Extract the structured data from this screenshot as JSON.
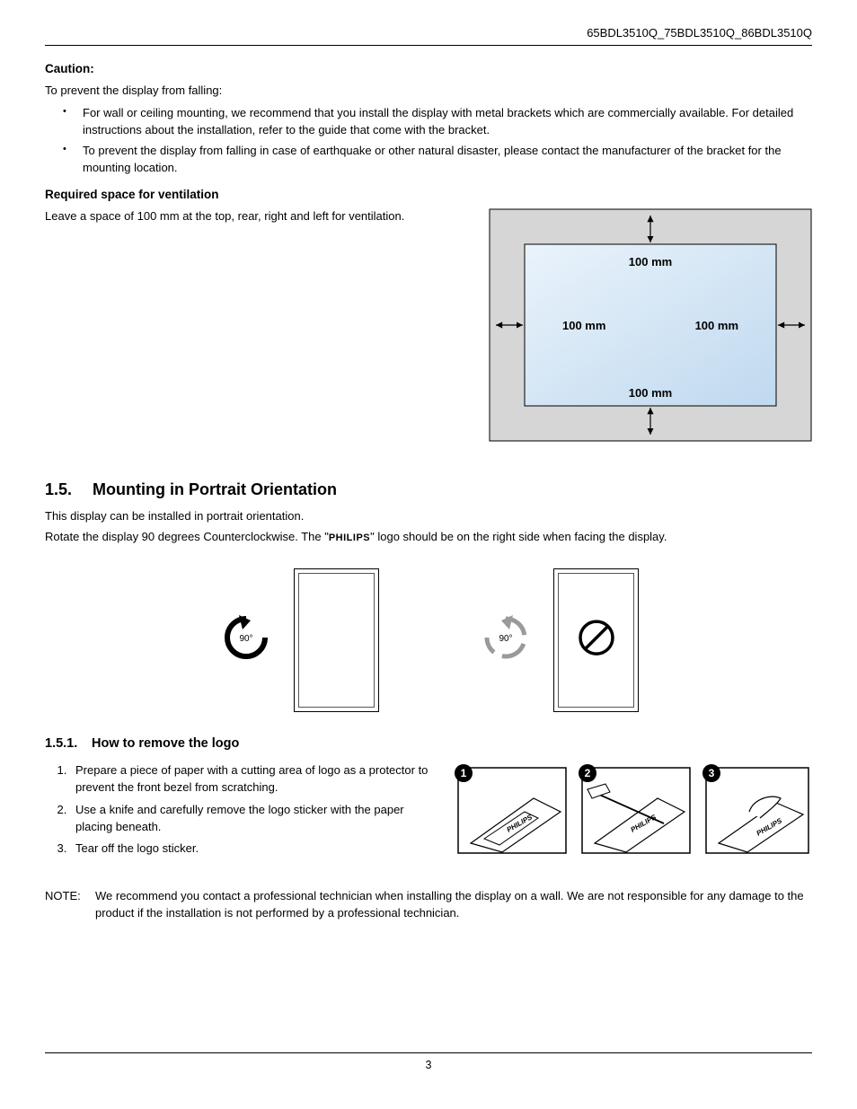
{
  "header": {
    "model_line": "65BDL3510Q_75BDL3510Q_86BDL3510Q"
  },
  "caution": {
    "heading": "Caution:",
    "intro": "To prevent the display from falling:",
    "bullets": [
      "For wall or ceiling mounting, we recommend that you install the display with metal brackets which are commercially available. For detailed instructions about the installation, refer to the guide that come with the bracket.",
      "To prevent the display from falling in case of earthquake or other natural disaster, please contact the manufacturer of the bracket for the mounting location."
    ]
  },
  "ventilation": {
    "heading": "Required space for ventilation",
    "text": "Leave a space of 100 mm at the top, rear, right and left for ventilation.",
    "labels": {
      "top": "100 mm",
      "left": "100 mm",
      "right": "100 mm",
      "bottom": "100 mm"
    }
  },
  "section15": {
    "number": "1.5.",
    "title": "Mounting in Portrait Orientation",
    "line1": "This display can be installed in portrait orientation.",
    "line2a": "Rotate the display 90 degrees Counterclockwise. The \"",
    "line2b": "\" logo should be on the right side when facing the display.",
    "philips": "PHILIPS",
    "deg_label": "90°"
  },
  "section151": {
    "number": "1.5.1.",
    "title": "How to remove the logo",
    "steps": [
      "Prepare a piece of paper with a cutting area of logo as a protector to prevent the front bezel from scratching.",
      "Use a knife and carefully remove the logo sticker with the paper placing beneath.",
      "Tear off the logo sticker."
    ],
    "badges": [
      "1",
      "2",
      "3"
    ],
    "sticker_label": "PHILIPS"
  },
  "note": {
    "label": "NOTE:",
    "text": "We recommend you contact a professional technician when installing the display on a wall. We are not responsible for any damage to the product if the installation is not performed by a professional technician."
  },
  "footer": {
    "page": "3"
  }
}
